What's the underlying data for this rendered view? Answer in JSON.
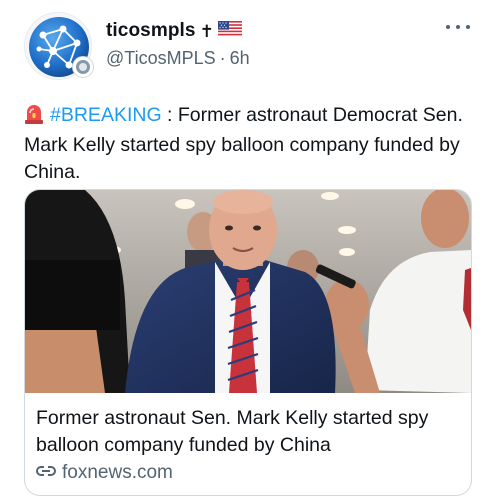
{
  "author": {
    "display_name": "ticosmpls",
    "handle": "@TicosMPLS",
    "separator": "·",
    "time": "6h",
    "name_emoji": [
      "cross-icon",
      "us-flag-icon"
    ]
  },
  "tweet": {
    "emoji": "siren-icon",
    "hashtag": "#BREAKING",
    "body": " : Former astronaut Democrat Sen. Mark Kelly started spy balloon company funded by China."
  },
  "card": {
    "title": "Former astronaut Sen. Mark Kelly started spy balloon company funded by China",
    "domain": "foxnews.com",
    "image": "photo-senator-with-reporters"
  },
  "colors": {
    "link_blue": "#1d9bf0",
    "secondary_text": "#536471",
    "primary_text": "#0f1419",
    "border": "#cfd9de"
  }
}
